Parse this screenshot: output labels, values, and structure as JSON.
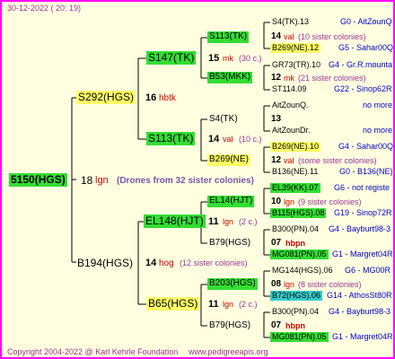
{
  "date": "30-12-2022 ( 20: 19)",
  "footer": {
    "copyright": "Copyright 2004-2022 @ Karl Kehrle Foundation",
    "site": "www.pedigreeapis.org"
  },
  "root": {
    "code": "5150(HGS)",
    "num": "18",
    "tag": "lgn",
    "note": "(Drones from 32 sister colonies)"
  },
  "gen1": [
    {
      "code": "S292(HGS)",
      "num": "16",
      "tag": "hbtk"
    },
    {
      "code": "B194(HGS)",
      "num": "14",
      "tag": "hog",
      "note": "(12 sister colonies)"
    }
  ],
  "gen2": [
    {
      "code": "S147(TK)",
      "num": "15",
      "tag": "mk",
      "note": "(30 c.)"
    },
    {
      "code": "S113(TK)",
      "num": "14",
      "tag": "val",
      "note": "(10 c.)"
    },
    {
      "code": "EL148(HJT)",
      "num": "11",
      "tag": "lgn",
      "note": "(2 c.)"
    },
    {
      "code": "B65(HGS)",
      "num": "11",
      "tag": "lgn",
      "note": "(2 c.)"
    }
  ],
  "gen3": [
    {
      "code": "S113(TK)",
      "num": "14",
      "tag": "val",
      "note": "(10 sister colonies)"
    },
    {
      "code": "B53(MKK)",
      "num": "12",
      "tag": "mk",
      "note": "(21 sister colonies)"
    },
    {
      "code": "S4(TK)",
      "num": "13",
      "tag": "",
      "note": ""
    },
    {
      "code": "B269(NE)",
      "num": "12",
      "tag": "val",
      "note": "(some sister colonies)"
    },
    {
      "code": "EL14(HJT)",
      "num": "10",
      "tag": "lgn",
      "note": "(9 sister colonies)"
    },
    {
      "code": "B79(HGS)",
      "num": "07",
      "tag": "hbpn",
      "note": ""
    },
    {
      "code": "B203(HGS)",
      "num": "08",
      "tag": "lgn",
      "note": "(8 sister colonies)"
    },
    {
      "code": "B79(HGS)",
      "num": "07",
      "tag": "hbpn",
      "note": ""
    }
  ],
  "gen4": [
    {
      "code": "S4(TK).13",
      "id": "G0 - AitZounQ"
    },
    {
      "code": "B269(NE).12",
      "id": "G5 - Sahar00Q"
    },
    {
      "code": "GR73(TR).10",
      "id": "G4 - Gr.R.mounta"
    },
    {
      "code": "ST114.09",
      "id": "G22 - Sinop62R"
    },
    {
      "code": "AitZounQ.",
      "id": "no more"
    },
    {
      "code": "AitZounDr.",
      "id": "no more"
    },
    {
      "code": "B269(NE).10",
      "id": "G4 - Sahar00Q"
    },
    {
      "code": "B136(NE).11",
      "id": "G0 - B136(NE)"
    },
    {
      "code": "EL39(KK).07",
      "id": "G6 - not registe"
    },
    {
      "code": "B115(HGS).08",
      "id": "G19 - Sinop72R"
    },
    {
      "code": "B300(PN).04",
      "id": "G4 - Bayburt98-3"
    },
    {
      "code": "MG081(PN).05",
      "id": "G1 - Margret04R"
    },
    {
      "code": "MG144(HGS).06",
      "id": "G6 - MG00R"
    },
    {
      "code": "B72(HGS).06",
      "id": "G14 - AthosSt80R"
    },
    {
      "code": "B300(PN).04",
      "id": "G4 - Bayburt98-3"
    },
    {
      "code": "MG081(PN).05",
      "id": "G1 - Margret04R"
    }
  ]
}
